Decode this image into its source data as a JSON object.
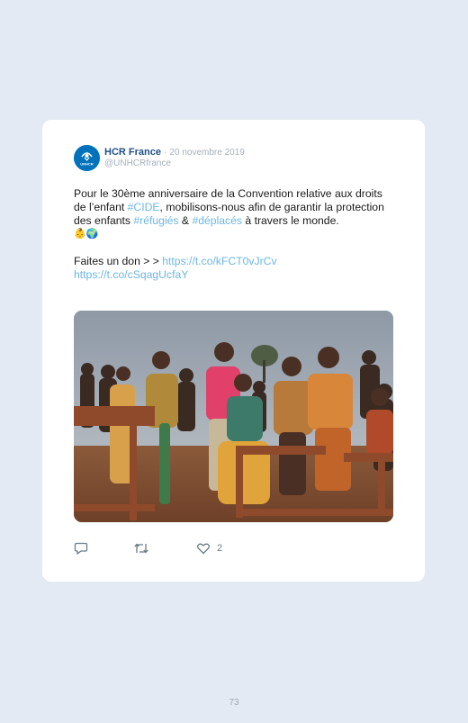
{
  "tweet": {
    "author_name": "HCR France",
    "separator": "·",
    "date": "20 novembre 2019",
    "handle": "@UNHCRfrance",
    "avatar_text": "UNHCR",
    "p1": {
      "t1": "Pour le 30ème anniversaire de la Convention relative aux droits de l’enfant ",
      "tag1": "#CIDE",
      "t2": ", mobilisons-nous afin de garantir la protection des enfants ",
      "tag2": "#réfugiés",
      "t3": " & ",
      "tag3": "#déplacés",
      "t4": " à travers le monde.",
      "emoji": "👶🌍"
    },
    "p2": {
      "t1": "Faites un don > > ",
      "link1": "https://t.co/kFCT0vJrCv",
      "link2": "https://t.co/cSqagUcfaY"
    },
    "photo_icon": "photo-children-refugees",
    "like_count": "2"
  },
  "page_number": "73",
  "colors": {
    "background": "#e4eaf4",
    "card": "#ffffff",
    "link": "#6cb6e6",
    "brand": "#0072bc"
  },
  "icons": [
    "reply-icon",
    "retweet-icon",
    "heart-icon"
  ]
}
